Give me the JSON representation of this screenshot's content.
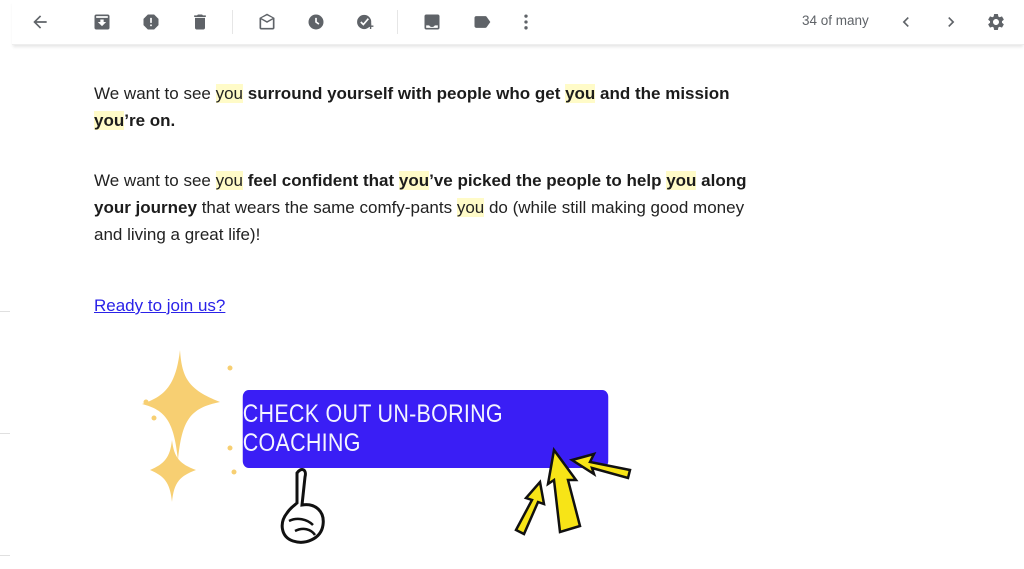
{
  "toolbar": {
    "icons": [
      {
        "name": "back-arrow-icon",
        "label": "Back"
      },
      {
        "name": "archive-icon",
        "label": "Archive"
      },
      {
        "name": "report-spam-icon",
        "label": "Report spam"
      },
      {
        "name": "delete-icon",
        "label": "Delete"
      },
      {
        "name": "mark-unread-icon",
        "label": "Mark as unread"
      },
      {
        "name": "snooze-icon",
        "label": "Snooze"
      },
      {
        "name": "add-task-icon",
        "label": "Add to tasks"
      },
      {
        "name": "move-to-icon",
        "label": "Move to"
      },
      {
        "name": "label-icon",
        "label": "Labels"
      },
      {
        "name": "more-icon",
        "label": "More"
      }
    ],
    "counter": "34 of many",
    "older_label": "Older",
    "newer_label": "Newer",
    "settings_label": "Settings"
  },
  "email": {
    "para1": {
      "intro": "We want to see ",
      "you1": "you",
      "bold1": " surround yourself with people who get ",
      "you2": "you",
      "bold2": " and the mission ",
      "you3": "you",
      "bold3": "’re on."
    },
    "para2": {
      "intro": "We want to see ",
      "you1": "you",
      "bold1": " feel confident that ",
      "you2": "you",
      "bold2": "’ve picked the people to help ",
      "you3": "you",
      "bold3": " along your journey",
      "plain1": " that wears the same comfy-pants ",
      "you4": "you",
      "plain2": " do (while still making good money and living a great life)!"
    },
    "link_text": "Ready to join us?",
    "cta_label": "CHECK OUT UN-BORING COACHING"
  },
  "colors": {
    "highlight": "#fffbc8",
    "link": "#2a22e8",
    "cta_background": "#3a1ef5",
    "sparkle": "#f7cf72",
    "arrow": "#f7e417"
  }
}
